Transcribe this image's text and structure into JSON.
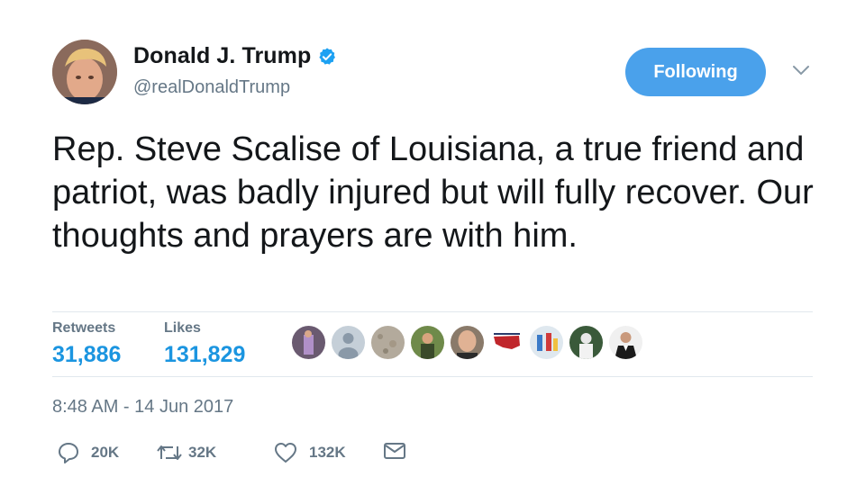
{
  "user": {
    "display_name": "Donald J. Trump",
    "handle": "@realDonaldTrump",
    "verified_icon": "verified-badge-icon"
  },
  "follow_button": {
    "label": "Following"
  },
  "menu": {
    "icon": "chevron-down-icon"
  },
  "tweet": {
    "text": "Rep. Steve Scalise of Louisiana, a true friend and patriot, was badly injured but will fully recover. Our thoughts and prayers are with him."
  },
  "stats": {
    "retweets_label": "Retweets",
    "retweets_value": "31,886",
    "likes_label": "Likes",
    "likes_value": "131,829"
  },
  "timestamp": "8:48 AM - 14 Jun 2017",
  "actions": {
    "reply_count": "20K",
    "retweet_count": "32K",
    "like_count": "132K",
    "reply_icon": "reply-icon",
    "retweet_icon": "retweet-icon",
    "like_icon": "heart-icon",
    "message_icon": "envelope-icon"
  },
  "colors": {
    "accent": "#1b95e0",
    "follow_button": "#4aa1eb",
    "secondary_text": "#657786"
  }
}
